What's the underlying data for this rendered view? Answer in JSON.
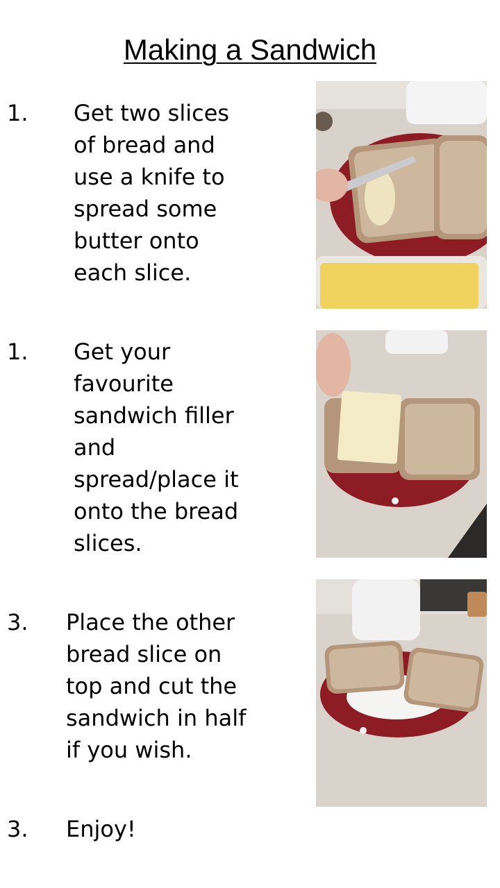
{
  "title": "Making a Sandwich",
  "steps": [
    {
      "number": "1.",
      "lines": [
        "Get two slices",
        "of bread and",
        "use a knife to",
        "spread some",
        "butter onto",
        "each slice."
      ],
      "photo": "bread-slices-being-buttered-photo"
    },
    {
      "number": "1.",
      "lines": [
        "Get your",
        "favourite",
        "sandwich filler",
        "and",
        "spread/place it",
        "onto the bread",
        "slices."
      ],
      "photo": "cheese-slice-placed-on-bread-photo"
    },
    {
      "number": "3.",
      "lines": [
        "Place the other",
        "bread slice on",
        "top and cut the",
        "sandwich in half",
        "if you wish."
      ],
      "photo": "sandwich-cut-in-half-photo"
    },
    {
      "number": "3.",
      "lines": [
        "Enjoy!"
      ]
    }
  ],
  "colors": {
    "counter": "#d6d0c8",
    "plate": "#8e1c24",
    "bread": "#b4967a",
    "butter": "#f2d25e",
    "cheese": "#f4ecc6",
    "kettle": "#f2f2f2"
  }
}
